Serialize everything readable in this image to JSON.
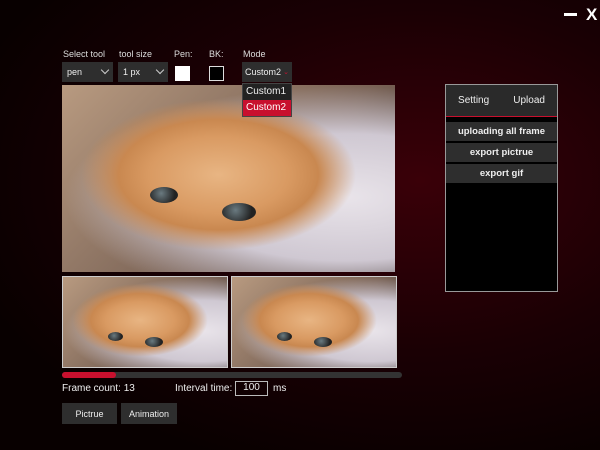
{
  "window": {
    "minimize_label": "–",
    "close_label": "X"
  },
  "toolbar": {
    "select_tool": {
      "label": "Select tool",
      "value": "pen"
    },
    "tool_size": {
      "label": "tool size",
      "value": "1 px"
    },
    "pen": {
      "label": "Pen:",
      "color": "#ffffff"
    },
    "bk": {
      "label": "BK:",
      "color": "#000000"
    },
    "mode": {
      "label": "Mode",
      "value": "Custom2",
      "options": [
        "Custom1",
        "Custom2"
      ]
    }
  },
  "frames": {
    "scroll_progress": 0.16
  },
  "footer": {
    "frame_count_label": "Frame count:",
    "frame_count": "13",
    "interval_label": "Interval time:",
    "interval_value": "100",
    "interval_unit": "ms",
    "picture_button": "Pictrue",
    "animation_button": "Animation"
  },
  "panel": {
    "tabs": [
      "Setting",
      "Upload"
    ],
    "buttons": [
      "uploading all frame",
      "export pictrue",
      "export gif"
    ]
  },
  "colors": {
    "accent": "#c8102e"
  }
}
